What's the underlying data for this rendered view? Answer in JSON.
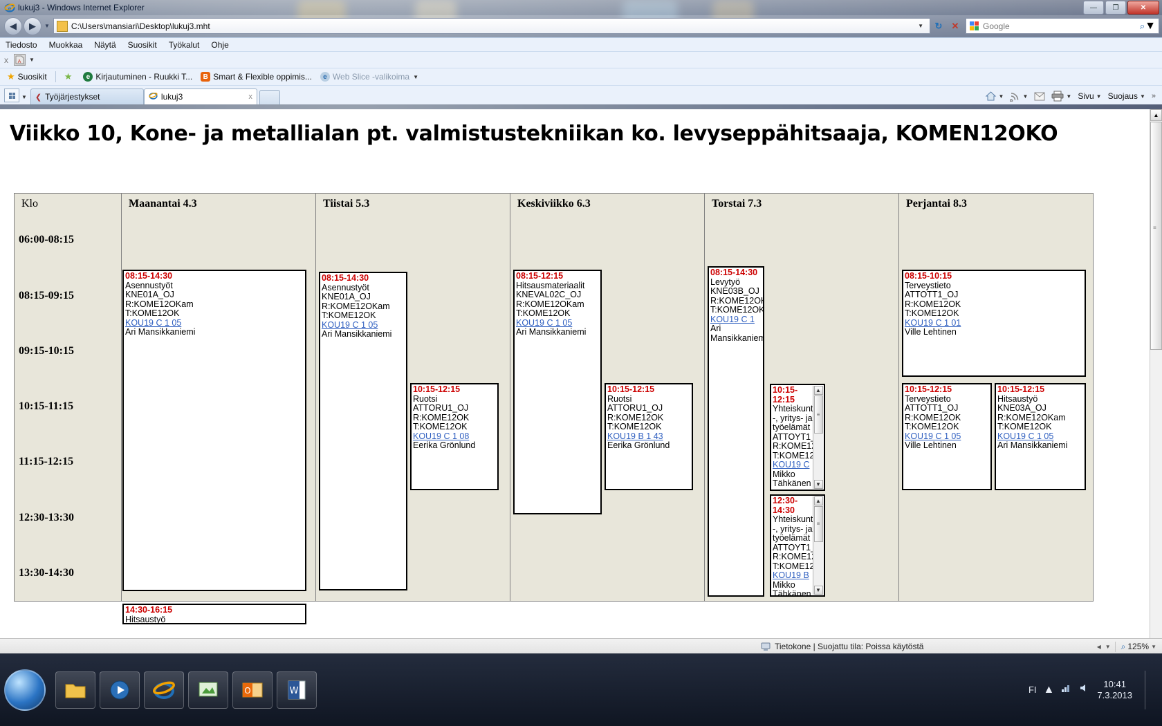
{
  "window": {
    "title": "lukuj3 - Windows Internet Explorer",
    "minimize_label": "—",
    "maximize_label": "❐",
    "close_label": "✕"
  },
  "address_bar": {
    "url": "C:\\Users\\mansiari\\Desktop\\lukuj3.mht",
    "back_glyph": "◀",
    "forward_glyph": "▶",
    "history_caret": "▼",
    "dropdown_caret": "▼",
    "refresh_glyph": "↻",
    "stop_glyph": "✕",
    "search_placeholder": "Google",
    "search_glyph": "⌕",
    "search_caret": "▼"
  },
  "menu_bar": {
    "items": [
      "Tiedosto",
      "Muokkaa",
      "Näytä",
      "Suosikit",
      "Työkalut",
      "Ohje"
    ]
  },
  "addon_bar": {
    "close_label": "x",
    "addon_caret": "▼"
  },
  "favorites_bar": {
    "label": "Suosikit",
    "items": [
      {
        "label": "Kirjautuminen - Ruukki T...",
        "icon": "e-icon",
        "color": "#1f7a3f"
      },
      {
        "label": "Smart & Flexible oppimis...",
        "icon": "b-icon",
        "color": "#e8620b"
      },
      {
        "label": "Web Slice -valikoima",
        "icon": "webslice-icon",
        "color": "#8aa7c4",
        "caret": "▼"
      }
    ]
  },
  "tabs": {
    "quick_tabs_label": "Pikavälilehdet",
    "tab_list_caret": "▼",
    "items": [
      {
        "label": "Työjärjestykset",
        "active": false,
        "icon": "bookmark-icon"
      },
      {
        "label": "lukuj3",
        "active": true,
        "icon": "ie-icon",
        "close": "x"
      }
    ],
    "new_tab_label": ""
  },
  "command_bar": {
    "home_caret": "▼",
    "feeds_caret": "▼",
    "mail_glyph": "✉",
    "print_caret": "▼",
    "page_label": "Sivu",
    "page_caret": "▼",
    "security_label": "Suojaus",
    "security_caret": "▼",
    "overflow_label": "»"
  },
  "page": {
    "heading": "Viikko 10, Kone- ja metallialan pt. valmistustekniikan ko. levyseppähitsaaja, KOMEN12OKO",
    "time_column_header": "Klo",
    "time_slots": [
      "06:00-08:15",
      "08:15-09:15",
      "09:15-10:15",
      "10:15-11:15",
      "11:15-12:15",
      "12:30-13:30",
      "13:30-14:30"
    ],
    "days": [
      {
        "header": "Maanantai 4.3",
        "events": [
          {
            "time": "08:15-14:30",
            "subject": "Asennustyöt",
            "code": "KNE01A_OJ",
            "room": "R:KOME12OKam",
            "group": "T:KOME12OK",
            "link": "KOU19  C  1  05",
            "teacher": "Ari Mansikkaniemi",
            "scrollable": false
          },
          {
            "time": "14:30-16:15",
            "subject": "Hitsaustyö",
            "code": "",
            "room": "",
            "group": "",
            "link": "",
            "teacher": "",
            "scrollable": false
          }
        ]
      },
      {
        "header": "Tiistai 5.3",
        "events": [
          {
            "time": "08:15-14:30",
            "subject": "Asennustyöt",
            "code": "KNE01A_OJ",
            "room": "R:KOME12OKam",
            "group": "T:KOME12OK",
            "link": "KOU19  C  1  05",
            "teacher": "Ari Mansikkaniemi",
            "scrollable": false
          },
          {
            "time": "10:15-12:15",
            "subject": "Ruotsi",
            "code": "ATTORU1_OJ",
            "room": "R:KOME12OK",
            "group": "T:KOME12OK",
            "link": "KOU19  C  1  08",
            "teacher": "Eerika Grönlund",
            "scrollable": false
          }
        ]
      },
      {
        "header": "Keskiviikko 6.3",
        "events": [
          {
            "time": "08:15-12:15",
            "subject": "Hitsausmateriaalit",
            "code": "KNEVAL02C_OJ",
            "room": "R:KOME12OKam",
            "group": "T:KOME12OK",
            "link": "KOU19  C  1  05",
            "teacher": "Ari Mansikkaniemi",
            "scrollable": false
          },
          {
            "time": "10:15-12:15",
            "subject": "Ruotsi",
            "code": "ATTORU1_OJ",
            "room": "R:KOME12OK",
            "group": "T:KOME12OK",
            "link": "KOU19  B  1  43",
            "teacher": "Eerika Grönlund",
            "scrollable": false
          }
        ]
      },
      {
        "header": "Torstai 7.3",
        "events": [
          {
            "time": "08:15-14:30",
            "subject": "Levytyö",
            "code": "KNE03B_OJ",
            "room": "R:KOME12OK",
            "group": "T:KOME12OK",
            "link": "KOU19  C  1",
            "teacher": "Ari Mansikkaniem",
            "scrollable": false
          },
          {
            "time": "10:15-12:15",
            "subject": "Yhteiskunt -, yritys- ja työelämät",
            "code": "ATTOYT1_",
            "room": "R:KOME12",
            "group": "T:KOME12",
            "link": "KOU19  C",
            "teacher": "Mikko Tähkänen",
            "scrollable": true
          },
          {
            "time": "12:30-14:30",
            "subject": "Yhteiskunt -, yritys- ja työelämät",
            "code": "ATTOYT1_",
            "room": "R:KOME12",
            "group": "T:KOME12",
            "link": "KOU19  B",
            "teacher": "Mikko Tähkänen",
            "scrollable": true
          }
        ]
      },
      {
        "header": "Perjantai 8.3",
        "events": [
          {
            "time": "08:15-10:15",
            "subject": "Terveystieto",
            "code": "ATTOTT1_OJ",
            "room": "R:KOME12OK",
            "group": "T:KOME12OK",
            "link": "KOU19  C  1  01",
            "teacher": "Ville Lehtinen",
            "scrollable": false
          },
          {
            "time": "10:15-12:15",
            "subject": "Terveystieto",
            "code": "ATTOTT1_OJ",
            "room": "R:KOME12OK",
            "group": "T:KOME12OK",
            "link": "KOU19  C  1  05",
            "teacher": "Ville Lehtinen",
            "scrollable": false
          },
          {
            "time": "10:15-12:15",
            "subject": "Hitsaustyö",
            "code": "KNE03A_OJ",
            "room": "R:KOME12OKam",
            "group": "T:KOME12OK",
            "link": "KOU19  C  1  05",
            "teacher": "Ari Mansikkaniemi",
            "scrollable": false
          }
        ]
      }
    ]
  },
  "status_bar": {
    "zone_text": "Tietokone | Suojattu tila: Poissa käytöstä",
    "zoom_label": "125%",
    "zoom_caret": "▼",
    "zoom_icon": "⌕"
  },
  "taskbar": {
    "start_label": "Start",
    "apps": [
      "explorer-icon",
      "media-player-icon",
      "internet-explorer-icon",
      "presentation-icon",
      "outlook-icon",
      "word-icon"
    ],
    "language": "FI",
    "time": "10:41",
    "date": "7.3.2013",
    "show_desktop_label": ""
  },
  "colors": {
    "event_time": "#cc0000",
    "event_link": "#2f5fc0",
    "table_bg": "#e8e6da",
    "event_bg": "#ffffff",
    "chrome_bg": "#eaf1fb"
  }
}
